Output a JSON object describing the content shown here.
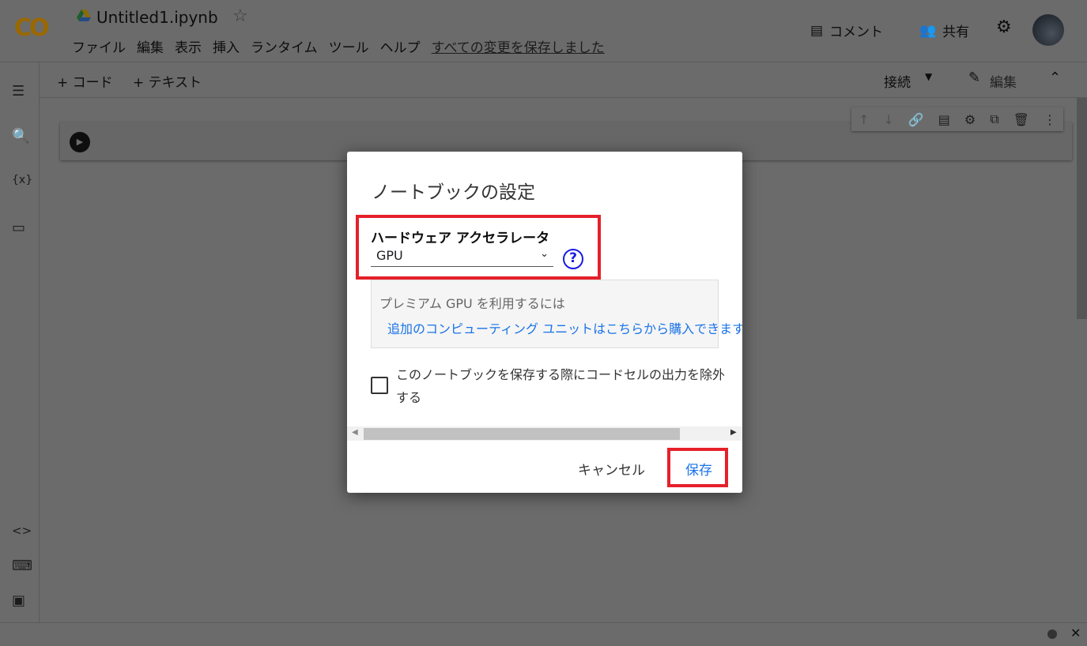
{
  "app": {
    "logo": "CO",
    "title": "Untitled1.ipynb"
  },
  "menu": [
    "ファイル",
    "編集",
    "表示",
    "挿入",
    "ランタイム",
    "ツール",
    "ヘルプ"
  ],
  "saved_status": "すべての変更を保存しました",
  "header": {
    "comment": "コメント",
    "share": "共有"
  },
  "toolbar": {
    "add_code": "+ コード",
    "add_text": "+ テキスト",
    "connect": "接続",
    "edit": "編集"
  },
  "dialog": {
    "title": "ノートブックの設定",
    "hardware_label": "ハードウェア アクセラレータ",
    "hardware_value": "GPU",
    "premium_text": "プレミアム GPU を利用するには",
    "premium_link": "追加のコンピューティング ユニットはこちらから購入できます",
    "checkbox_label": "このノートブックを保存する際にコードセルの出力を除外する",
    "checkbox_checked": false,
    "cancel": "キャンセル",
    "save": "保存"
  },
  "colors": {
    "highlight": "#e5202a",
    "link": "#1a73e8",
    "help": "#1a1ae6"
  }
}
